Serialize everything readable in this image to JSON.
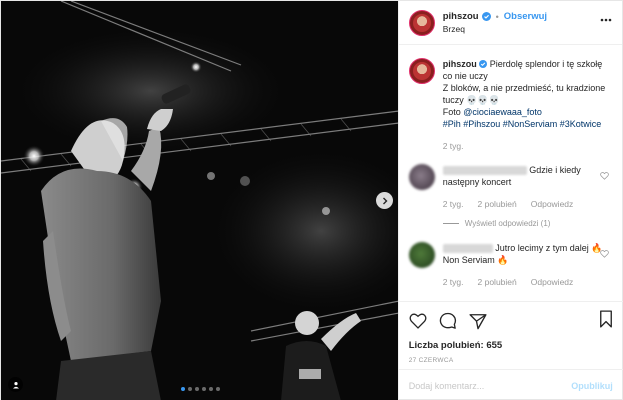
{
  "header": {
    "username": "pihszou",
    "separator": "•",
    "follow_label": "Obserwuj",
    "location": "Brzeq"
  },
  "caption": {
    "username": "pihszou",
    "line1": "Pierdolę splendor i tę szkołę co nie uczy",
    "line2": "Z bloków, a nie przedmieść, tu kradzione tuczy 💀💀💀",
    "foto_prefix": "Foto ",
    "foto_mention": "@ciociaewaaa_foto",
    "hashtags": "#Pih #Pihszou #NonServiam #3Kotwice",
    "time": "2 tyg."
  },
  "comments": [
    {
      "text": "Gdzie i kiedy następny koncert",
      "time": "2 tyg.",
      "likes": "2 polubień",
      "reply": "Odpowiedz",
      "view_replies": "Wyświetl odpowiedzi (1)"
    },
    {
      "text": "Jutro lecimy z tym dalej 🔥 Non Serviam 🔥",
      "time": "2 tyg.",
      "likes": "2 polubień",
      "reply": "Odpowiedz"
    }
  ],
  "likes_label": "Liczba polubień:",
  "likes_count": "655",
  "date": "27 CZERWCA",
  "comment_input": {
    "placeholder": "Dodaj komentarz..."
  },
  "publish_label": "Opublikuj",
  "carousel": {
    "count": 6,
    "active": 0
  },
  "colors": {
    "accent": "#3897f0",
    "verified": "#3897f0",
    "muted": "#999999"
  }
}
